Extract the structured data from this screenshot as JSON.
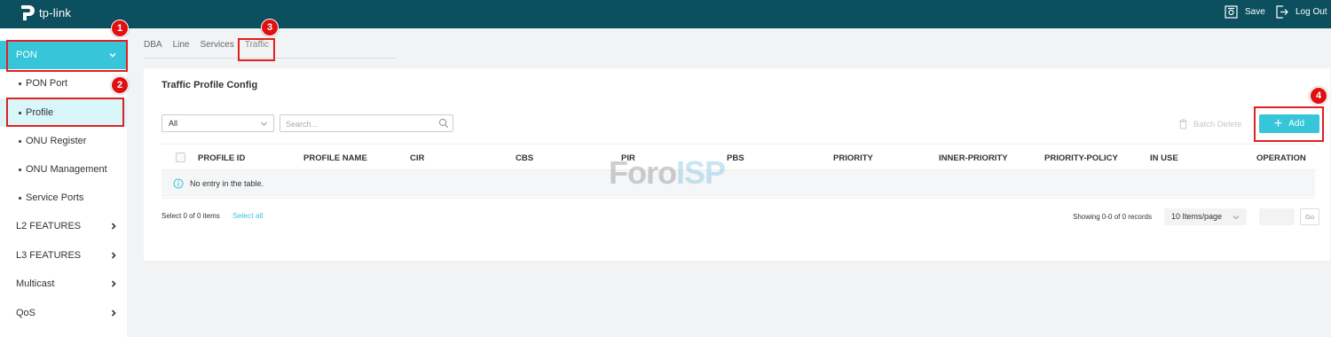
{
  "brand": {
    "name": "tp-link"
  },
  "topbar": {
    "save_label": "Save",
    "logout_label": "Log Out"
  },
  "sidebar": {
    "pon_label": "PON",
    "sub_items": [
      "PON Port",
      "Profile",
      "ONU Register",
      "ONU Management",
      "Service Ports"
    ],
    "sections": [
      "L2 FEATURES",
      "L3 FEATURES",
      "Multicast",
      "QoS"
    ]
  },
  "tabs": [
    "DBA",
    "Line",
    "Services",
    "Traffic"
  ],
  "panel": {
    "title": "Traffic Profile Config",
    "filter_value": "All",
    "search_placeholder": "Search...",
    "batch_delete_label": "Batch Delete",
    "add_label": "Add"
  },
  "table": {
    "columns": [
      "PROFILE ID",
      "PROFILE NAME",
      "CIR",
      "CBS",
      "PIR",
      "PBS",
      "PRIORITY",
      "INNER-PRIORITY",
      "PRIORITY-POLICY",
      "IN USE",
      "OPERATION"
    ],
    "empty_message": "No entry in the table."
  },
  "footer": {
    "selected_text": "Select 0 of 0 items",
    "select_all_label": "Select all",
    "showing_text": "Showing 0-0 of 0 records",
    "per_page_value": "10 Items/page",
    "go_label": "Go"
  },
  "annotations": [
    "1",
    "2",
    "3",
    "4"
  ],
  "watermark": {
    "part1": "Foro",
    "part2": "ISP"
  },
  "colors": {
    "topbar": "#0c4f5e",
    "accent": "#37c6d9",
    "highlight": "#e02020"
  }
}
